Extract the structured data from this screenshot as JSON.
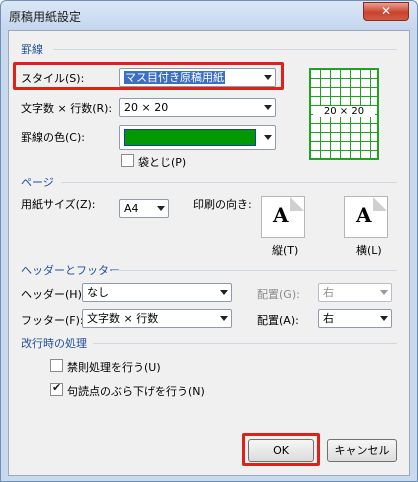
{
  "window": {
    "title": "原稿用紙設定",
    "close_symbol": "✕"
  },
  "keisen": {
    "section_title": "罫線",
    "style_label": "スタイル(S):",
    "style_value": "マス目付き原稿用紙",
    "chars_label": "文字数 × 行数(R):",
    "chars_value": "20 × 20",
    "color_label": "罫線の色(C):",
    "color_value": "#009900",
    "fukuro_label": "袋とじ(P)",
    "fukuro_checked": false,
    "preview_label": "20 × 20"
  },
  "page": {
    "section_title": "ページ",
    "paper_label": "用紙サイズ(Z):",
    "paper_value": "A4",
    "orientation_label": "印刷の向き:",
    "portrait_label": "縦(T)",
    "landscape_label": "横(L)",
    "orientation_letter": "A"
  },
  "header_footer": {
    "section_title": "ヘッダーとフッター",
    "header_label": "ヘッダー(H):",
    "header_value": "なし",
    "header_align_label": "配置(G):",
    "header_align_value": "右",
    "footer_label": "フッター(F):",
    "footer_value": "文字数 × 行数",
    "footer_align_label": "配置(A):",
    "footer_align_value": "右"
  },
  "line_break": {
    "section_title": "改行時の処理",
    "kinsoku_label": "禁則処理を行う(U)",
    "kinsoku_checked": false,
    "burasage_label": "句読点のぶら下げを行う(N)",
    "burasage_checked": true
  },
  "buttons": {
    "ok_label": "OK",
    "cancel_label": "キャンセル"
  },
  "colors": {
    "highlight_red": "#e0201a",
    "section_blue": "#1f4e9a",
    "grid_green": "#1fa41f"
  }
}
